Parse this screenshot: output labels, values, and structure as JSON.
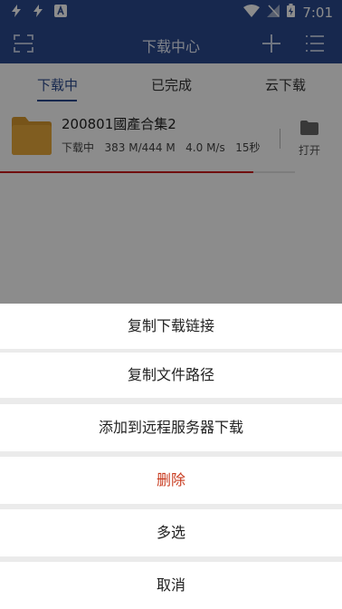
{
  "status_bar": {
    "time": "7:01",
    "icons": [
      "flash-icon",
      "flash-icon",
      "a-badge-icon",
      "wifi-icon",
      "no-sim-icon",
      "battery-charging-icon"
    ]
  },
  "app_bar": {
    "title": "下载中心",
    "left_icon": "scan-icon",
    "right_icons": [
      "add-icon",
      "menu-list-icon"
    ]
  },
  "tabs": [
    {
      "label": "下载中",
      "active": true
    },
    {
      "label": "已完成",
      "active": false
    },
    {
      "label": "云下载",
      "active": false
    }
  ],
  "download_item": {
    "name": "200801國產合集2",
    "status": "下载中",
    "size": "383 M/444 M",
    "speed": "4.0 M/s",
    "remaining": "15秒",
    "progress": 0.86,
    "open_label": "打开",
    "folder_color": "#e9a93b"
  },
  "sheet_options": [
    {
      "label": "复制下载链接",
      "danger": false
    },
    {
      "label": "复制文件路径",
      "danger": false
    },
    {
      "label": "添加到远程服务器下载",
      "danger": false
    },
    {
      "label": "删除",
      "danger": true
    },
    {
      "label": "多选",
      "danger": false
    },
    {
      "label": "取消",
      "danger": false
    }
  ],
  "colors": {
    "primary": "#2b4a8f",
    "progress": "#cc1b1b",
    "danger": "#c83a1e"
  }
}
